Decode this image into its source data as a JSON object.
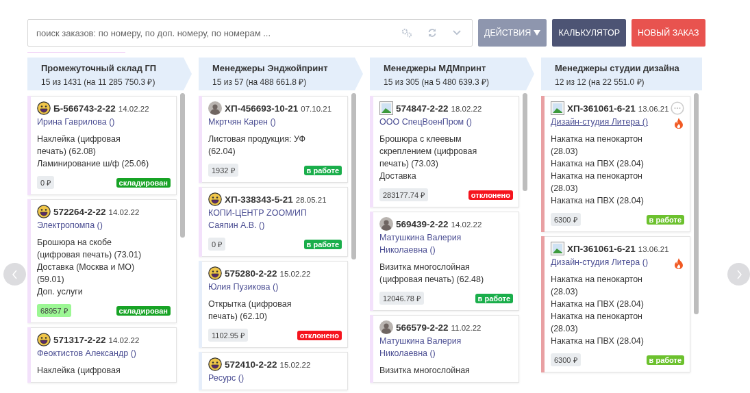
{
  "search": {
    "placeholder": "поиск заказов: по номеру, по доп. номеру, по номерам ..."
  },
  "buttons": [
    {
      "label": "ДЕЙСТВИЯ",
      "kind": "dropdown"
    },
    {
      "label": "КАЛЬКУЛЯТОР",
      "kind": "dark"
    },
    {
      "label": "НОВЫЙ ЗАКАЗ",
      "kind": "danger"
    }
  ],
  "columns": [
    {
      "title": "Промежуточный склад ГП",
      "summary": "15 из 1431 (на 11 285 750.3 ₽)",
      "arrow": true,
      "cards": [
        {
          "kind": "smiley",
          "number": "Б-566743-2-22",
          "date": "14.02.22",
          "customer": "Ирина Гаврилова ()",
          "underline": false,
          "items": [
            "Наклейка (цифровая печать) (62.08)",
            "Ламинирование ш/ф (25.06)"
          ],
          "price": "0 ₽",
          "price_highlight": false,
          "status": {
            "label": "складирован",
            "color": "#17a325"
          },
          "color": "#f3e1fb",
          "urgent": false,
          "menu": false
        },
        {
          "kind": "smiley",
          "number": "572264-2-22",
          "date": "14.02.22",
          "customer": "Электропомпа ()",
          "underline": false,
          "items": [
            "Брошюра на скобе (цифровая печать) (73.01)",
            "Доставка (Москва и МО) (59.01)",
            "Доп. услуги"
          ],
          "price": "68957 ₽",
          "price_highlight": true,
          "status": {
            "label": "складирован",
            "color": "#17a325"
          },
          "color": "#f3e1fb",
          "urgent": false,
          "menu": false
        },
        {
          "kind": "smiley",
          "number": "571317-2-22",
          "date": "14.02.22",
          "customer": "Феоктистов Александр ()",
          "underline": false,
          "items": [
            "Наклейка (цифровая"
          ],
          "color": "#f3e1fb",
          "urgent": false,
          "menu": false
        }
      ]
    },
    {
      "title": "Менеджеры Энджойпринт",
      "summary": "15 из 57 (на 488 661.8 ₽)",
      "arrow": true,
      "cards": [
        {
          "kind": "photo",
          "number": "ХП-456693-10-21",
          "date": "07.10.21",
          "customer": "Мкртчян Карен ()",
          "underline": false,
          "items": [
            "Листовая продукция: УФ (62.04)"
          ],
          "price": "1932 ₽",
          "price_highlight": false,
          "status": {
            "label": "в работе",
            "color": "#1aae4b"
          },
          "color": "#f3e1fb",
          "urgent": false,
          "menu": false
        },
        {
          "kind": "smiley",
          "number": "ХП-338343-5-21",
          "date": "28.05.21",
          "customer": "КОПИ-ЦЕНТР ZOOM/ИП Саяпин А.В. ()",
          "underline": false,
          "price": "0 ₽",
          "price_highlight": false,
          "status": {
            "label": "в работе",
            "color": "#1aae4b"
          },
          "color": "#f3e1fb",
          "urgent": false,
          "menu": false
        },
        {
          "kind": "smiley",
          "number": "575280-2-22",
          "date": "15.02.22",
          "customer": "Юлия Пузикова ()",
          "underline": false,
          "items": [
            "Открытка (цифровая печать) (62.10)"
          ],
          "price": "1102.95 ₽",
          "price_highlight": false,
          "status": {
            "label": "отклонено",
            "color": "#f5141e"
          },
          "color": "#e6eefa",
          "urgent": false,
          "menu": false
        },
        {
          "kind": "smiley",
          "number": "572410-2-22",
          "date": "15.02.22",
          "customer": "Ресурс ()",
          "underline": false,
          "color": "#e6eefa",
          "urgent": false,
          "menu": false
        }
      ]
    },
    {
      "title": "Менеджеры МДМпринт",
      "summary": "15 из 305 (на 5 480 639.3 ₽)",
      "arrow": true,
      "cards": [
        {
          "kind": "image",
          "number": "574847-2-22",
          "date": "18.02.22",
          "customer": "ООО СпецВоенПром ()",
          "underline": false,
          "items": [
            "Брошюра с клеевым скреплением (цифровая печать) (73.03)",
            "Доставка"
          ],
          "price": "283177.74 ₽",
          "price_highlight": false,
          "status": {
            "label": "отклонено",
            "color": "#f5141e"
          },
          "color": "#f3e1fb",
          "urgent": false,
          "menu": false
        },
        {
          "kind": "photo",
          "number": "569439-2-22",
          "date": "14.02.22",
          "customer": "Матушкина Валерия Николаевна ()",
          "underline": false,
          "items": [
            "Визитка многослойная (цифровая печать) (62.48)"
          ],
          "price": "12046.78 ₽",
          "price_highlight": false,
          "status": {
            "label": "в работе",
            "color": "#1aae4b"
          },
          "color": "#f3e1fb",
          "urgent": false,
          "menu": false
        },
        {
          "kind": "photo",
          "number": "566579-2-22",
          "date": "11.02.22",
          "customer": "Матушкина Валерия Николаевна ()",
          "underline": false,
          "items": [
            "Визитка многослойная"
          ],
          "color": "#f3e1fb",
          "urgent": false,
          "menu": false
        }
      ]
    },
    {
      "title": "Менеджеры студии дизайна",
      "summary": "12 из 12 (на 22 551.0 ₽)",
      "arrow": false,
      "cards": [
        {
          "kind": "image",
          "number": "ХП-361061-6-21",
          "date": "13.06.21",
          "customer": "Дизайн-студия Литера ()",
          "underline": true,
          "items": [
            "Накатка на пенокартон (28.03)",
            "Накатка на ПВХ (28.04)",
            "Накатка на пенокартон (28.03)",
            "Накатка на ПВХ (28.04)"
          ],
          "price": "6300 ₽",
          "price_highlight": false,
          "status": {
            "label": "в работе",
            "color": "#6cc12e"
          },
          "color": "#e9a0a3",
          "urgent": true,
          "menu": true
        },
        {
          "kind": "image",
          "number": "ХП-361061-6-21",
          "date": "13.06.21",
          "customer": "Дизайн-студия Литера ()",
          "underline": false,
          "items": [
            "Накатка на пенокартон (28.03)",
            "Накатка на ПВХ (28.04)",
            "Накатка на пенокартон (28.03)",
            "Накатка на ПВХ (28.04)"
          ],
          "price": "6300 ₽",
          "price_highlight": false,
          "status": {
            "label": "в работе",
            "color": "#6cc12e"
          },
          "color": "#e9a0a3",
          "urgent": true,
          "menu": false
        }
      ]
    }
  ]
}
